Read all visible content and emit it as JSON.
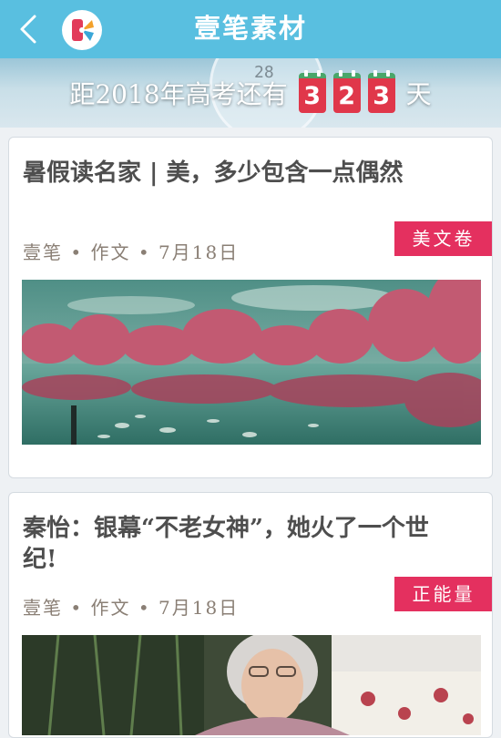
{
  "header": {
    "title": "壹笔素材",
    "back_icon": "chevron-left-icon",
    "logo_icon": "app-logo-icon",
    "bg_color": "#59bfe0"
  },
  "countdown": {
    "prefix": "距2018年高考还有",
    "digits": [
      "3",
      "2",
      "3"
    ],
    "suffix": "天",
    "clock_text": "28"
  },
  "articles": [
    {
      "title": "暑假读名家 | 美，多少包含一点偶然",
      "meta": "壹笔 • 作文 • 7月18日",
      "tag": "美文卷",
      "image": "lake-pink-trees-image"
    },
    {
      "title": "秦怡：银幕“不老女神”，她火了一个世纪!",
      "meta": "壹笔 • 作文 • 7月18日",
      "tag": "正能量",
      "image": "elderly-actress-portrait-image"
    }
  ],
  "colors": {
    "tag": "#e4305f",
    "digit": "#e0374a"
  }
}
